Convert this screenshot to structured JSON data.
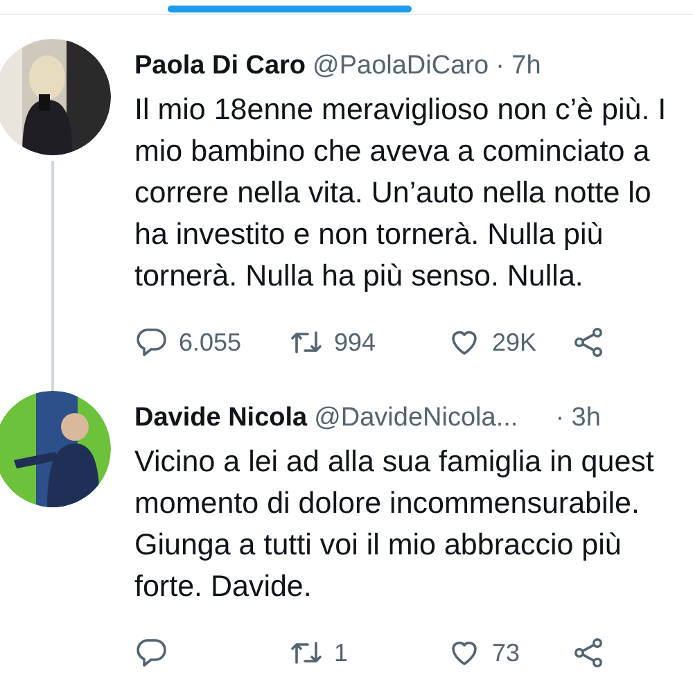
{
  "tweets": [
    {
      "name": "Paola Di Caro",
      "handle": "@PaolaDiCaro",
      "time": "· 7h",
      "thread_line": true,
      "avatar": {
        "kind": "picture"
      },
      "lines": [
        "Il mio 18enne meraviglioso non c’è più. I",
        "mio bambino che aveva a cominciato a",
        "correre nella vita. Un’auto nella notte lo",
        "ha investito e non tornerà. Nulla più",
        "tornerà. Nulla ha più senso. Nulla."
      ],
      "actions": [
        {
          "kind": "reply",
          "count": "6.055"
        },
        {
          "kind": "retweet",
          "count": "994"
        },
        {
          "kind": "like",
          "count": "29K"
        },
        {
          "kind": "share"
        }
      ]
    },
    {
      "name": "Davide Nicola",
      "handle": "@DavideNicola...",
      "time": "· 3h",
      "thread_line": false,
      "avatar": {
        "kind": "picture"
      },
      "lines": [
        "Vicino a lei ad alla sua famiglia in quest",
        "momento di dolore incommensurabile.",
        "Giunga a tutti voi il mio abbraccio più",
        "forte. Davide."
      ],
      "actions": [
        {
          "kind": "reply"
        },
        {
          "kind": "retweet",
          "count": "1"
        },
        {
          "kind": "like",
          "count": "73"
        },
        {
          "kind": "share"
        }
      ]
    }
  ]
}
